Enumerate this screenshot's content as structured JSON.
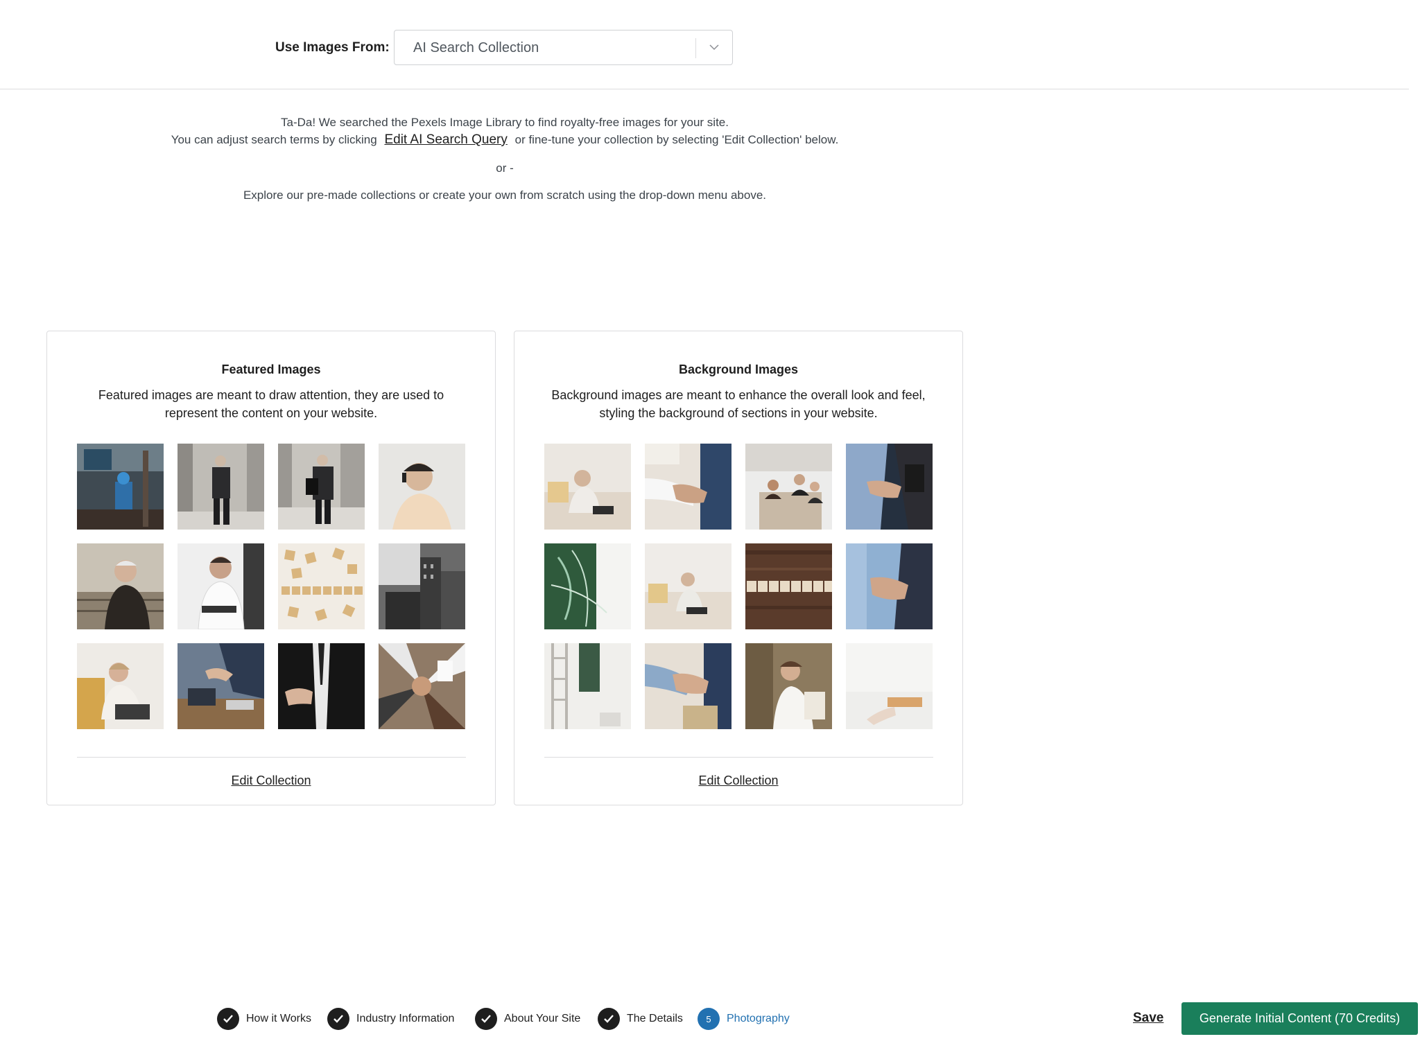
{
  "selector": {
    "label": "Use Images From:",
    "value": "AI Search Collection"
  },
  "intro": {
    "line1": "Ta-Da! We searched the Pexels Image Library to find royalty-free images for your site.",
    "line2_before": "You can adjust search terms by clicking",
    "link": "Edit AI Search Query",
    "line2_after": "or fine-tune your collection by selecting 'Edit Collection' below.",
    "or": "or -",
    "line3": "Explore our pre-made collections or create your own from scratch using the drop-down menu above."
  },
  "featured": {
    "title": "Featured Images",
    "description": "Featured images are meant to draw attention, they are used to represent the content on your website.",
    "edit_label": "Edit Collection"
  },
  "background": {
    "title": "Background Images",
    "description": "Background images are meant to enhance the overall look and feel, styling the background of sections in your website.",
    "edit_label": "Edit Collection"
  },
  "steps": [
    {
      "label": "How it Works",
      "status": "done"
    },
    {
      "label": "Industry Information",
      "status": "done"
    },
    {
      "label": "About Your Site",
      "status": "done"
    },
    {
      "label": "The Details",
      "status": "done"
    },
    {
      "label": "Photography",
      "status": "active",
      "number": "5"
    }
  ],
  "footer": {
    "save_label": "Save",
    "generate_label": "Generate Initial Content (70 Credits)"
  },
  "colors": {
    "accent": "#2271b1",
    "generate_button": "#1a7f5b"
  }
}
